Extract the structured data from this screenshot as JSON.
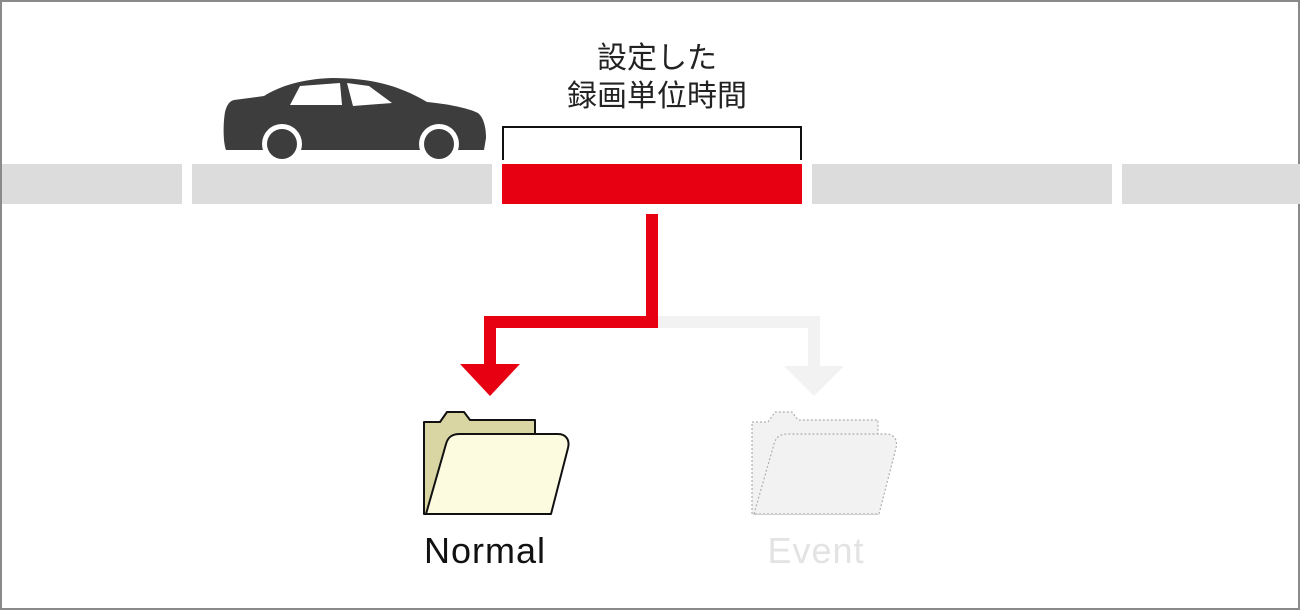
{
  "caption": {
    "line1": "設定した",
    "line2": "録画単位時間"
  },
  "folders": {
    "normal": {
      "label": "Normal"
    },
    "event": {
      "label": "Event"
    }
  },
  "colors": {
    "accent": "#e60012",
    "road_segment": "#dcdcdc",
    "car": "#3d3d3d",
    "normal_folder_back": "#d9d6a4",
    "normal_folder_front": "#fdfbdf",
    "faded": "#f2f2f2"
  },
  "icons": [
    "car-icon",
    "bracket-icon",
    "arrow-icon",
    "folder-icon"
  ]
}
